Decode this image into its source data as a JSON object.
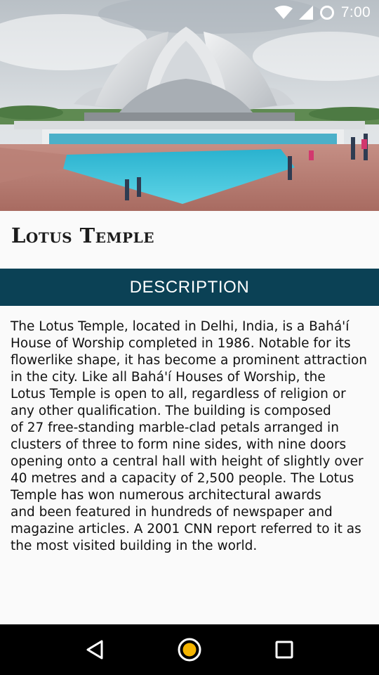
{
  "status_bar": {
    "time": "7:00",
    "icons": [
      "wifi-icon",
      "cellular-signal-icon",
      "sync-circle-icon"
    ]
  },
  "hero_image": {
    "subject": "lotus-temple-photo"
  },
  "place": {
    "title": "Lotus Temple"
  },
  "section": {
    "header_label": "DESCRIPTION"
  },
  "description": {
    "text": "The Lotus Temple, located in Delhi, India, is a Bahá'í\nHouse of Worship completed in 1986. Notable for its\nflowerlike shape, it has become a prominent attraction\nin the city. Like all Bahá'í Houses of Worship, the\nLotus Temple is open to all, regardless of religion or\nany other qualification. The building is composed\nof 27 free-standing marble-clad petals arranged in\nclusters of three to form nine sides, with nine doors\nopening onto a central hall with height of slightly over\n40 metres and a capacity of 2,500 people. The Lotus\nTemple has won numerous architectural awards\nand been featured in hundreds of newspaper and\nmagazine articles. A 2001 CNN report referred to it as\nthe most visited building in the world."
  },
  "nav_bar": {
    "buttons": [
      "back-icon",
      "home-icon",
      "recents-icon"
    ],
    "home_accent": "#f4b400"
  },
  "colors": {
    "header_bg": "#0b4155",
    "page_bg": "#fafafa",
    "nav_bg": "#000000"
  }
}
